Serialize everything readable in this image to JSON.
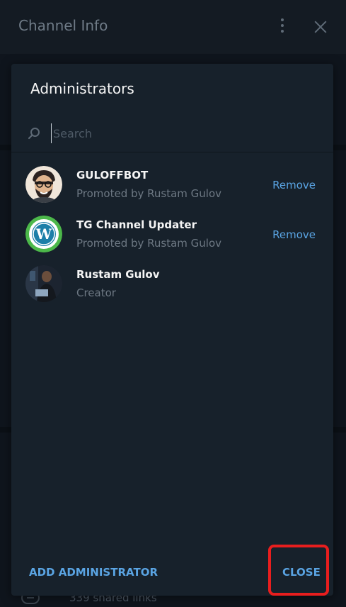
{
  "header": {
    "title": "Channel Info"
  },
  "background": {
    "shared_links": "339 shared links"
  },
  "dialog": {
    "title": "Administrators",
    "search": {
      "placeholder": "Search",
      "value": ""
    },
    "admins": [
      {
        "name": "GULOFFBOT",
        "subtitle": "Promoted by Rustam Gulov",
        "action": "Remove",
        "avatar": "cartoon-man-avatar"
      },
      {
        "name": "TG Channel Updater",
        "subtitle": "Promoted by Rustam Gulov",
        "action": "Remove",
        "avatar": "wordpress-logo-avatar"
      },
      {
        "name": "Rustam Gulov",
        "subtitle": "Creator",
        "action": "",
        "avatar": "photo-avatar"
      }
    ],
    "add_label": "ADD ADMINISTRATOR",
    "close_label": "CLOSE"
  },
  "colors": {
    "accent": "#5aa4e3",
    "highlight": "#e81e1e",
    "dialog_bg": "#17212b"
  }
}
